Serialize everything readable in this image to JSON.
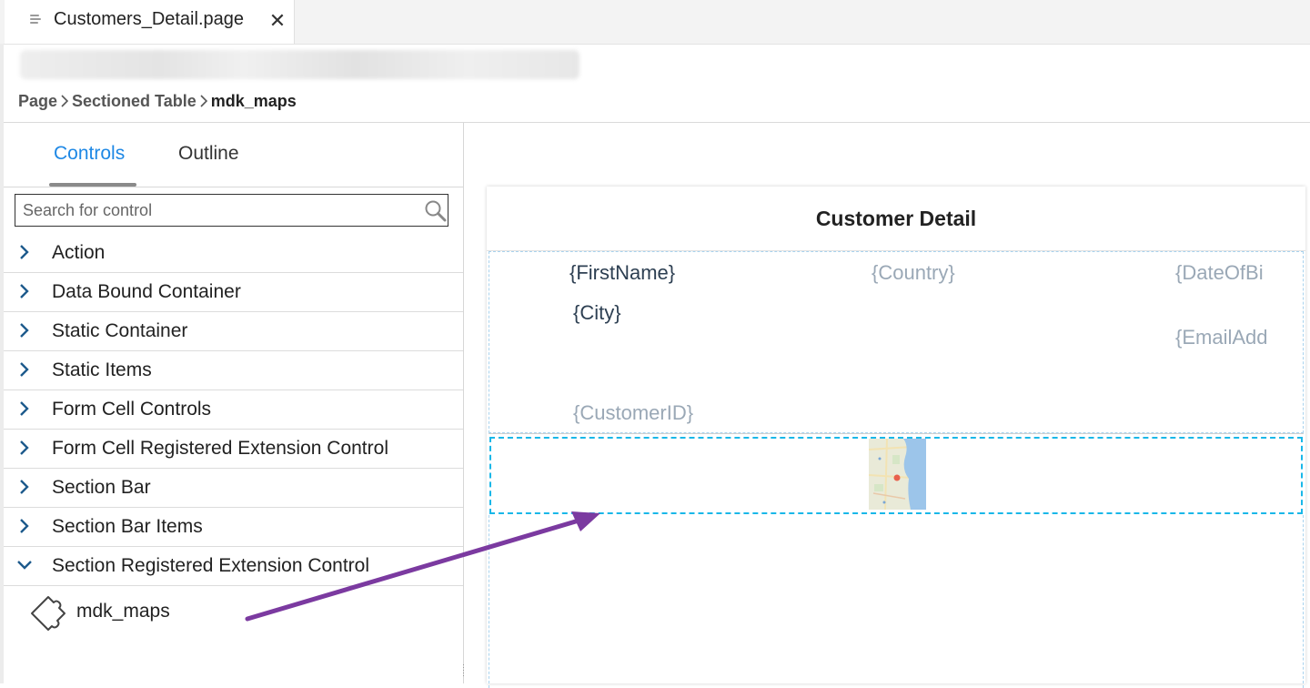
{
  "editor_tab": {
    "label": "Customers_Detail.page",
    "close_glyph": "✕"
  },
  "breadcrumb": {
    "items": [
      "Page",
      "Sectioned Table",
      "mdk_maps"
    ]
  },
  "panel": {
    "tabs": [
      "Controls",
      "Outline"
    ],
    "active_tab": "Controls",
    "search_placeholder": "Search for control",
    "categories": [
      {
        "label": "Action",
        "expanded": false
      },
      {
        "label": "Data Bound Container",
        "expanded": false
      },
      {
        "label": "Static Container",
        "expanded": false
      },
      {
        "label": "Static Items",
        "expanded": false
      },
      {
        "label": "Form Cell Controls",
        "expanded": false
      },
      {
        "label": "Form Cell Registered Extension Control",
        "expanded": false
      },
      {
        "label": "Section Bar",
        "expanded": false
      },
      {
        "label": "Section Bar Items",
        "expanded": false
      },
      {
        "label": "Section Registered Extension Control",
        "expanded": true
      }
    ],
    "sub_item": {
      "label": "mdk_maps",
      "icon": "puzzle-icon"
    }
  },
  "preview": {
    "title": "Customer Detail",
    "fields": {
      "first_name": "{FirstName}",
      "country": "{Country}",
      "date_of_birth": "{DateOfBi",
      "city": "{City}",
      "email": "{EmailAdd",
      "customer_id": "{CustomerID}"
    }
  },
  "colors": {
    "accent": "#1e88e5",
    "chevron": "#1d5a8c",
    "selection": "#19b7e8",
    "arrow": "#7b3aa0"
  }
}
